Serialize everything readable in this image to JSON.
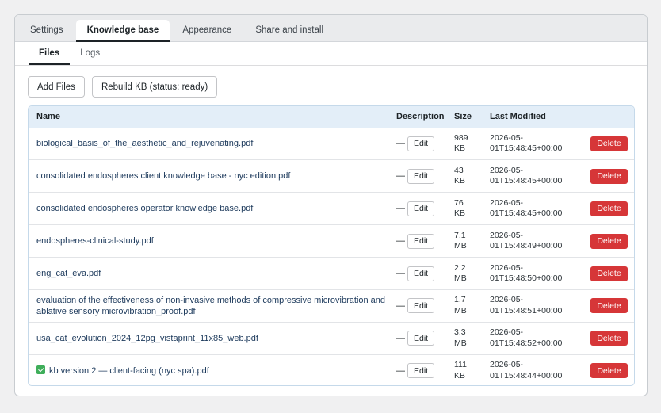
{
  "top_tabs": [
    {
      "label": "Settings"
    },
    {
      "label": "Knowledge base"
    },
    {
      "label": "Appearance"
    },
    {
      "label": "Share and install"
    }
  ],
  "sub_tabs": [
    {
      "label": "Files"
    },
    {
      "label": "Logs"
    }
  ],
  "actions": {
    "add_files": "Add Files",
    "rebuild": "Rebuild KB (status: ready)"
  },
  "table": {
    "headers": {
      "name": "Name",
      "description": "Description",
      "size": "Size",
      "modified": "Last Modified",
      "actions": ""
    },
    "edit_label": "Edit",
    "delete_label": "Delete",
    "rows": [
      {
        "name": "biological_basis_of_the_aesthetic_and_rejuvenating.pdf",
        "description": "—",
        "size_num": "989",
        "size_unit": "KB",
        "mod_date": "2026-05-",
        "mod_time": "01T15:48:45+00:00",
        "checked": false
      },
      {
        "name": "consolidated endospheres client knowledge base - nyc edition.pdf",
        "description": "—",
        "size_num": "43",
        "size_unit": "KB",
        "mod_date": "2026-05-",
        "mod_time": "01T15:48:45+00:00",
        "checked": false
      },
      {
        "name": "consolidated endospheres operator knowledge base.pdf",
        "description": "—",
        "size_num": "76",
        "size_unit": "KB",
        "mod_date": "2026-05-",
        "mod_time": "01T15:48:45+00:00",
        "checked": false
      },
      {
        "name": "endospheres-clinical-study.pdf",
        "description": "—",
        "size_num": "7.1",
        "size_unit": "MB",
        "mod_date": "2026-05-",
        "mod_time": "01T15:48:49+00:00",
        "checked": false
      },
      {
        "name": "eng_cat_eva.pdf",
        "description": "—",
        "size_num": "2.2",
        "size_unit": "MB",
        "mod_date": "2026-05-",
        "mod_time": "01T15:48:50+00:00",
        "checked": false
      },
      {
        "name": "evaluation of the effectiveness of non-invasive methods of compressive microvibration and ablative sensory microvibration_proof.pdf",
        "description": "—",
        "size_num": "1.7",
        "size_unit": "MB",
        "mod_date": "2026-05-",
        "mod_time": "01T15:48:51+00:00",
        "checked": false
      },
      {
        "name": "usa_cat_evolution_2024_12pg_vistaprint_11x85_web.pdf",
        "description": "—",
        "size_num": "3.3",
        "size_unit": "MB",
        "mod_date": "2026-05-",
        "mod_time": "01T15:48:52+00:00",
        "checked": false
      },
      {
        "name": "kb version 2 — client-facing (nyc spa).pdf",
        "description": "—",
        "size_num": "111",
        "size_unit": "KB",
        "mod_date": "2026-05-",
        "mod_time": "01T15:48:44+00:00",
        "checked": true
      }
    ]
  },
  "colors": {
    "accent": "#1d2327",
    "header_bg": "#e3eef8",
    "delete": "#d63638",
    "check": "#3fae5a"
  },
  "icons": {
    "check": "check-square-icon"
  }
}
